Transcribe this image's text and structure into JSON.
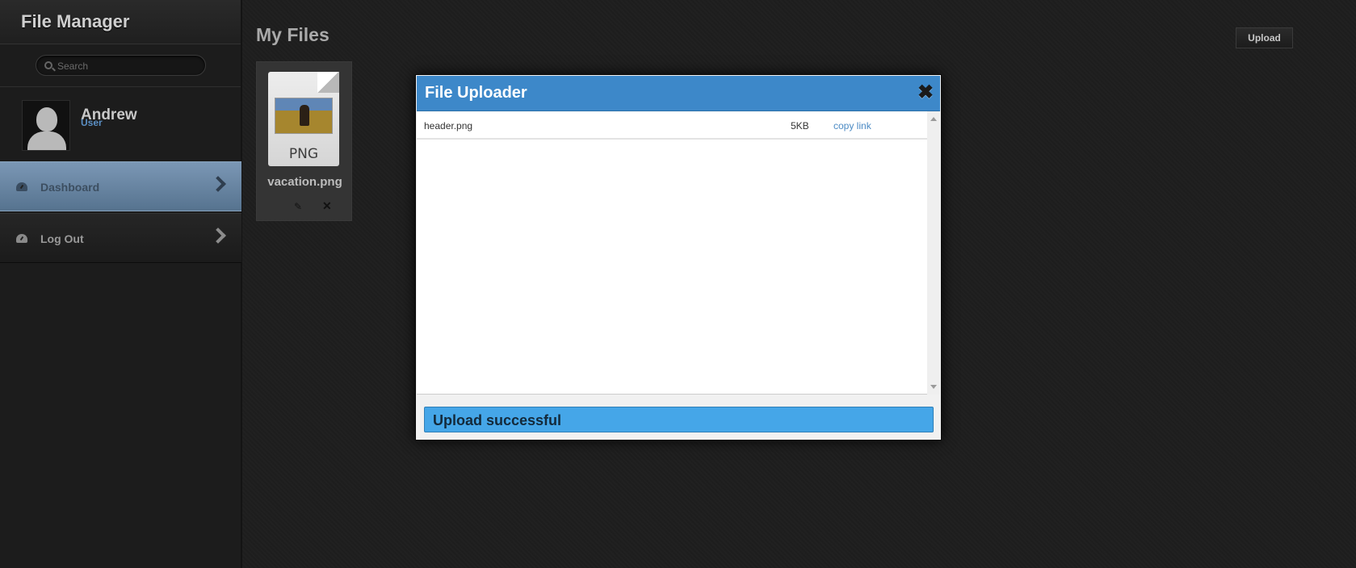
{
  "sidebar": {
    "app_title": "File Manager",
    "search": {
      "placeholder": "Search",
      "value": ""
    },
    "user": {
      "name": "Andrew",
      "role": "User"
    },
    "nav": [
      {
        "label": "Dashboard",
        "icon": "dashboard-icon",
        "active": true
      },
      {
        "label": "Log Out",
        "icon": "dashboard-icon",
        "active": false
      }
    ]
  },
  "main": {
    "page_title": "My Files",
    "upload_label": "Upload",
    "files": [
      {
        "name": "vacation.png",
        "type_label": "PNG",
        "icon": "png-file-icon"
      }
    ]
  },
  "modal": {
    "title": "File Uploader",
    "rows": [
      {
        "name": "header.png",
        "size": "5KB",
        "action": "copy link"
      }
    ],
    "status": "Upload successful"
  },
  "colors": {
    "accent": "#3d88c9",
    "status_bar": "#45a6e8",
    "nav_active": "#6a87a6",
    "link": "#4b8ac4",
    "background": "#1e1e1e"
  }
}
